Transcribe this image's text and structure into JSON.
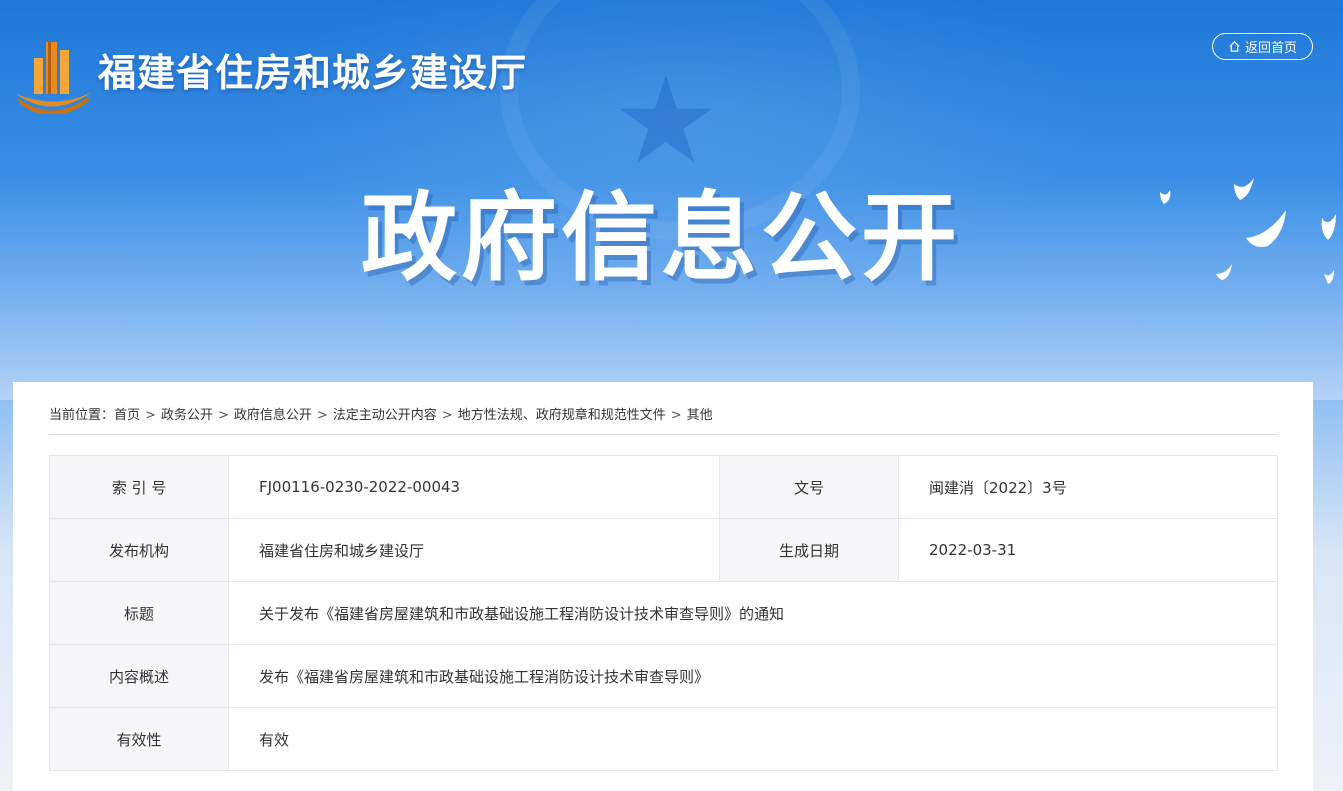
{
  "header": {
    "site_title": "福建省住房和城乡建设厅",
    "home_button_label": "返回首页",
    "banner_title": "政府信息公开"
  },
  "breadcrumb": {
    "prefix": "当前位置：",
    "items": [
      "首页",
      "政务公开",
      "政府信息公开",
      "法定主动公开内容",
      "地方性法规、政府规章和规范性文件",
      "其他"
    ],
    "separator": ">"
  },
  "info": {
    "index_label": "索 引 号",
    "index_value": "FJ00116-0230-2022-00043",
    "doc_no_label": "文号",
    "doc_no_value": "闽建消〔2022〕3号",
    "publisher_label": "发布机构",
    "publisher_value": "福建省住房和城乡建设厅",
    "date_label": "生成日期",
    "date_value": "2022-03-31",
    "title_label": "标题",
    "title_value": "关于发布《福建省房屋建筑和市政基础设施工程消防设计技术审查导则》的通知",
    "summary_label": "内容概述",
    "summary_value": "发布《福建省房屋建筑和市政基础设施工程消防设计技术审查导则》",
    "validity_label": "有效性",
    "validity_value": "有效"
  },
  "colors": {
    "banner_blue": "#2f86e0",
    "logo_orange": "#e88a1e",
    "label_bg": "#f5f6f8",
    "border": "#e3e6ea"
  }
}
